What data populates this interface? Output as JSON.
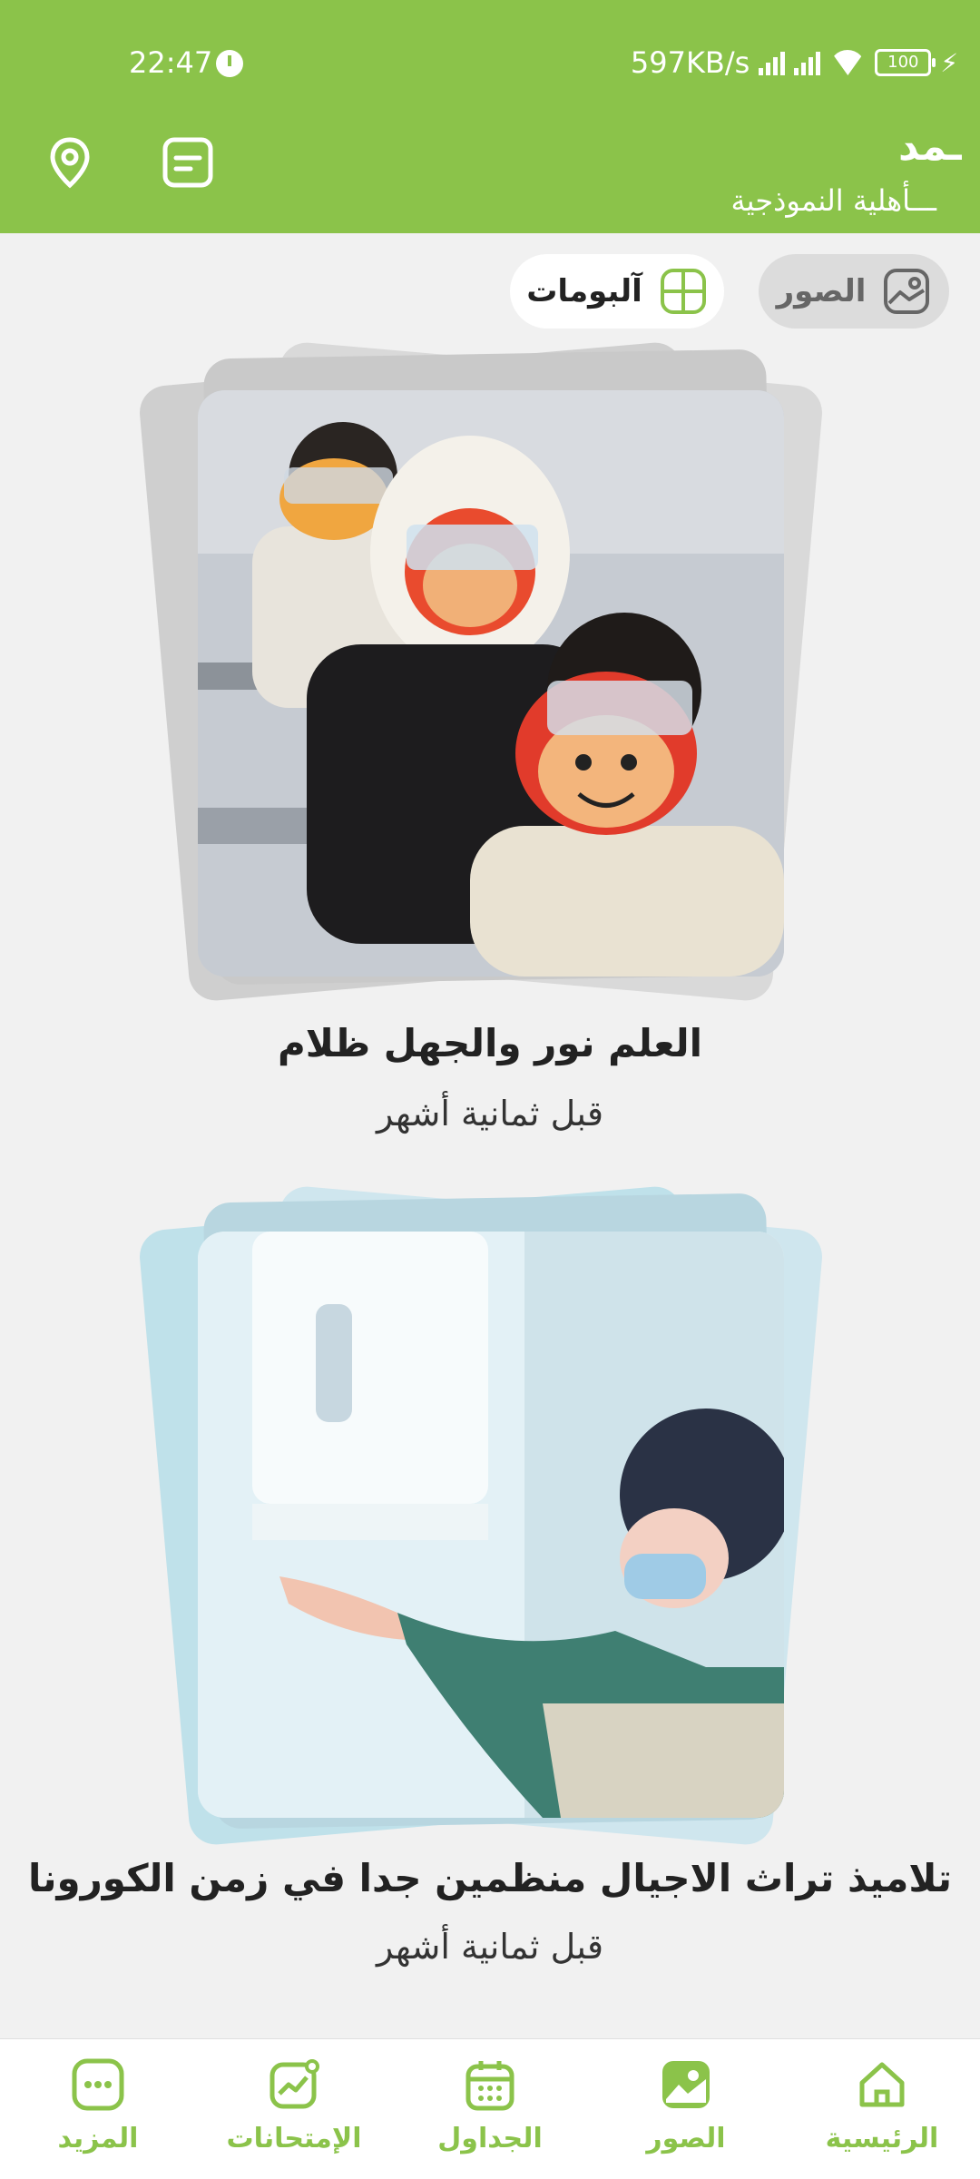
{
  "status_bar": {
    "time": "22:47",
    "network_speed": "597KB/s",
    "battery": "100"
  },
  "header": {
    "title": "ـمد",
    "subtitle": "ـــأهلية النموذجية"
  },
  "switcher": {
    "photos_label": "الصور",
    "albums_label": "آلبومات"
  },
  "albums": [
    {
      "title": "العلم نور والجهل ظلام",
      "time": "قبل ثمانية أشهر"
    },
    {
      "title": "تلاميذ تراث الاجيال منظمين جدا في زمن الكورونا",
      "time": "قبل ثمانية أشهر"
    }
  ],
  "bottom_nav": [
    {
      "label": "الرئيسية",
      "icon": "home-icon"
    },
    {
      "label": "الصور",
      "icon": "image-icon"
    },
    {
      "label": "الجداول",
      "icon": "calendar-icon"
    },
    {
      "label": "الإمتحانات",
      "icon": "chart-icon"
    },
    {
      "label": "المزيد",
      "icon": "more-icon"
    }
  ],
  "colors": {
    "brand": "#8bc34a",
    "background": "#f1f1f1"
  }
}
